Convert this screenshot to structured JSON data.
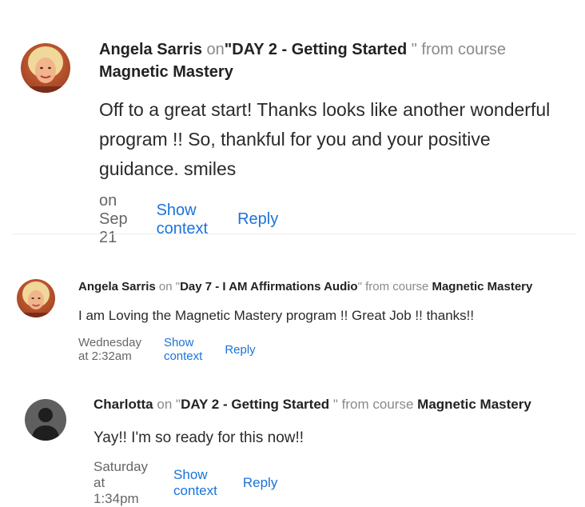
{
  "comments": [
    {
      "author": "Angela Sarris",
      "on_word": "on",
      "lesson_open_quote": "\"",
      "lesson": "DAY 2 - Getting Started",
      "lesson_close_quote": " \"",
      "from_course": "from course",
      "course": "Magnetic Mastery",
      "text": "Off to a great start! Thanks looks like another wonderful program !! So, thankful for you and your positive guidance. smiles",
      "date": "on Sep 21",
      "show_context": "Show context",
      "reply": "Reply",
      "avatar_icon": "user-photo"
    },
    {
      "author": "Angela Sarris",
      "on_word": "on",
      "lesson_open_quote": "\"",
      "lesson": "Day 7 - I AM Affirmations Audio",
      "lesson_close_quote": "\"",
      "from_course": "from course",
      "course": "Magnetic Mastery",
      "text": "I am Loving the Magnetic Mastery program !! Great Job !! thanks!!",
      "date": "Wednesday at 2:32am",
      "show_context": "Show context",
      "reply": "Reply",
      "avatar_icon": "user-photo"
    },
    {
      "author": "Charlotta",
      "on_word": "on",
      "lesson_open_quote": "\"",
      "lesson": "DAY 2 - Getting Started",
      "lesson_close_quote": " \"",
      "from_course": "from course",
      "course": "Magnetic Mastery",
      "text": "Yay!! I'm so ready for this now!!",
      "date": "Saturday at 1:34pm",
      "show_context": "Show context",
      "reply": "Reply",
      "avatar_icon": "default-user-silhouette"
    }
  ],
  "colors": {
    "link": "#1a73d9",
    "muted": "#8a8a8a",
    "text": "#2a2a2a",
    "divider": "#ececec"
  }
}
